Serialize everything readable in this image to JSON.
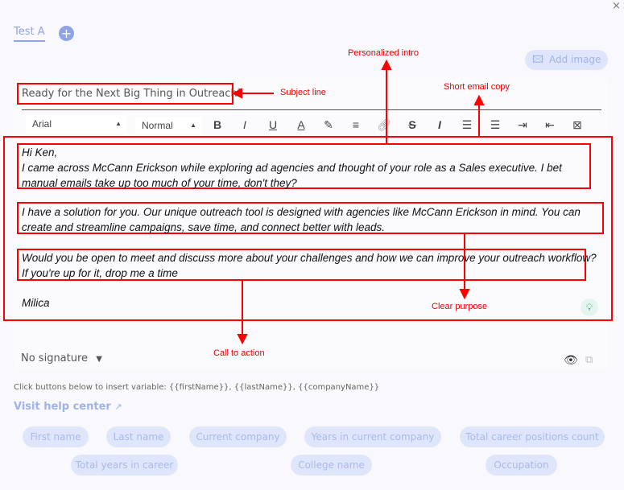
{
  "tabs": {
    "active": "Test A",
    "add": "+"
  },
  "close": "×",
  "add_image": "Add image",
  "subject": "Ready for the Next Big Thing in Outreach?",
  "toolbar": {
    "font": "Arial",
    "size": "Normal",
    "buttons": [
      "bold",
      "italic",
      "underline",
      "text-color",
      "highlight",
      "align",
      "link",
      "strikethrough",
      "clear-format",
      "ordered-list",
      "bullet-list",
      "indent",
      "outdent",
      "template"
    ]
  },
  "email": {
    "greeting": "Hi Ken,",
    "intro": "I came across McCann Erickson while exploring ad agencies and thought of your role as a Sales executive. I bet manual emails take up too much of your time, don't they?",
    "copy": "I have a solution for you. Our unique outreach tool is designed with agencies like McCann Erickson in mind. You can create and streamline campaigns, save time, and connect better with leads.",
    "cta1": "Would you be open to meet and discuss more about your challenges and how we can improve your outreach workflow?",
    "cta2": "If you're up for it, drop me a time",
    "signoff": "Milica"
  },
  "annotations": {
    "intro": "Personalized intro",
    "subject": "Subject line",
    "copy": "Short email copy",
    "purpose": "Clear purpose",
    "cta": "Call to action"
  },
  "signature": "No signature",
  "hint": "Click buttons below to insert variable: {{firstName}}, {{lastName}}, {{companyName}}",
  "help": "Visit help center",
  "variables": [
    "First name",
    "Last name",
    "Current company",
    "Years in current company",
    "Total career positions count",
    "Total years in career",
    "College name",
    "Occupation"
  ],
  "colors": {
    "accent": "#8fa4e8",
    "annotation": "#ff0000",
    "chip": "#dfe6fb"
  }
}
